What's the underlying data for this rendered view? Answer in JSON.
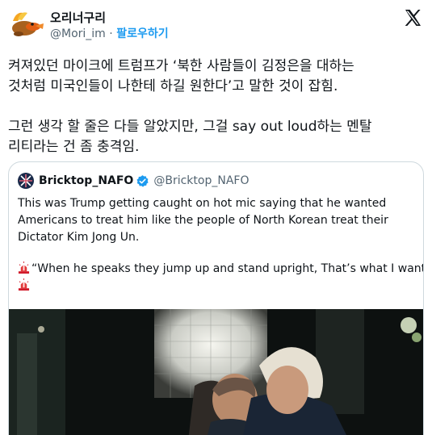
{
  "author": {
    "display_name": "오리너구리",
    "handle": "@Mori_im",
    "separator": "·",
    "follow_label": "팔로우하기"
  },
  "tweet": {
    "lines": [
      "켜져있던 마이크에 트럼프가 ‘북한 사람들이 김정은을 대하는",
      "것처럼 미국인들이 나한테 하길 원한다’고 말한 것이 잡힘.",
      "그런 생각 할 줄은 다들 알았지만, 그걸 say out loud하는 멘탈",
      "리티라는 건 좀 충격임."
    ]
  },
  "quote": {
    "display_name": "Bricktop_NAFO",
    "handle": "@Bricktop_NAFO",
    "lines": [
      "This was Trump getting caught on hot mic saying that he wanted",
      "Americans to treat him like the people of North Korean treat their",
      "Dictator Kim Jong Un.",
      "“When he speaks they jump up and stand upright, That’s what I want”"
    ]
  },
  "icons": {
    "platform_logo": "x-logo-icon",
    "verified_badge": "verified-badge-icon",
    "siren": "police-light-icon"
  },
  "colors": {
    "link_blue": "#1d9bf0",
    "secondary_text": "#536471",
    "border": "#cfd9de",
    "verified_blue": "#1d9bf0"
  }
}
